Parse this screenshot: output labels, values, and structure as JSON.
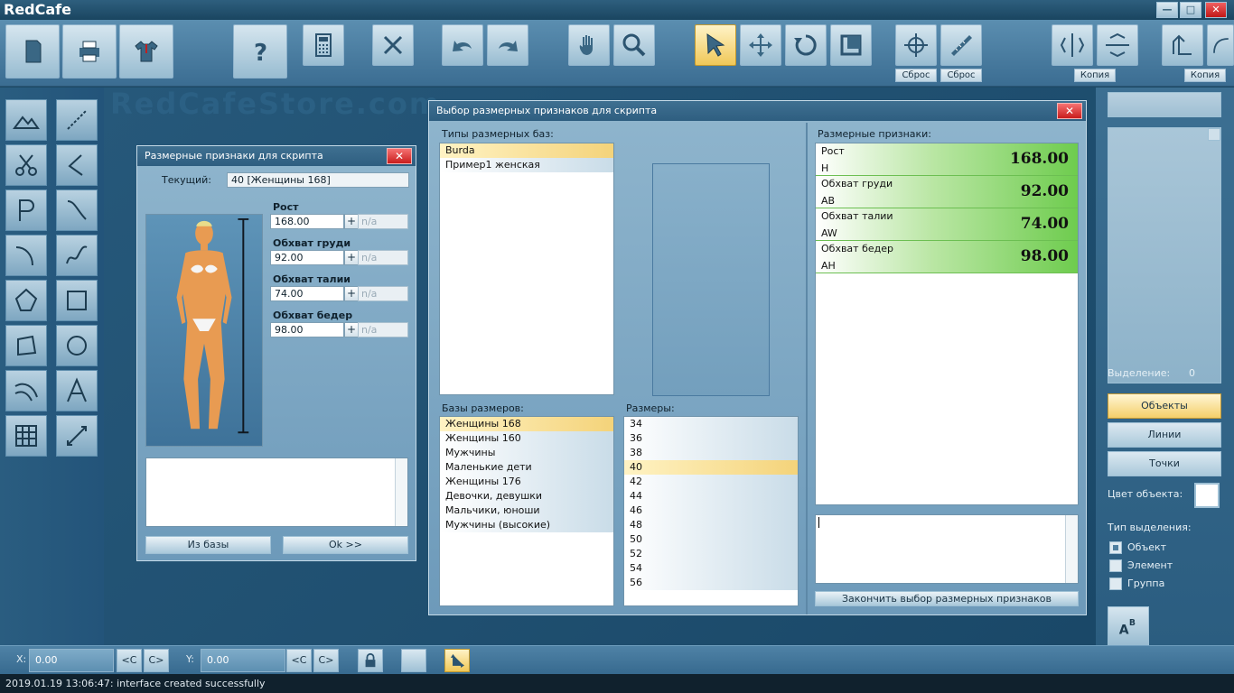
{
  "app": {
    "title": "RedCafe",
    "watermark": "RedCafeStore.com"
  },
  "window_controls": {
    "minimize": "—",
    "maximize": "□",
    "close": "✕"
  },
  "toolbar": {
    "labels": {
      "reset1": "Сброс",
      "reset2": "Сброс",
      "copy1": "Копия",
      "copy2": "Копия"
    }
  },
  "dialog_small": {
    "title": "Размерные признаки для скрипта",
    "current_label": "Текущий:",
    "current_value": "40  [Женщины 168]",
    "measures": [
      {
        "label": "Рост",
        "value": "168.00",
        "na": "n/a"
      },
      {
        "label": "Обхват груди",
        "value": "92.00",
        "na": "n/a"
      },
      {
        "label": "Обхват талии",
        "value": "74.00",
        "na": "n/a"
      },
      {
        "label": "Обхват бедер",
        "value": "98.00",
        "na": "n/a"
      }
    ],
    "plus": "+",
    "btn_from_base": "Из базы",
    "btn_ok": "Ok >>"
  },
  "dialog_main": {
    "title": "Выбор размерных признаков для скрипта",
    "types_label": "Типы размерных баз:",
    "types": [
      "Burda",
      "Пример1 женская"
    ],
    "bases_label": "Базы размеров:",
    "bases": [
      "Женщины 168",
      "Женщины 160",
      "Мужчины",
      "Маленькие дети",
      "Женщины 176",
      "Девочки, девушки",
      "Мальчики, юноши",
      "Мужчины (высокие)"
    ],
    "sizes_label": "Размеры:",
    "sizes": [
      "34",
      "36",
      "38",
      "40",
      "42",
      "44",
      "46",
      "48",
      "50",
      "52",
      "54",
      "56"
    ],
    "features_label": "Размерные признаки:",
    "features": [
      {
        "name": "Рост",
        "code": "H",
        "value": "168.00"
      },
      {
        "name": "Обхват груди",
        "code": "AB",
        "value": "92.00"
      },
      {
        "name": "Обхват талии",
        "code": "AW",
        "value": "74.00"
      },
      {
        "name": "Обхват бедер",
        "code": "AH",
        "value": "98.00"
      }
    ],
    "finish_button": "Закончить выбор размерных признаков"
  },
  "right_panel": {
    "selection_label": "Выделение:",
    "selection_count": "0",
    "btn_objects": "Объекты",
    "btn_lines": "Линии",
    "btn_points": "Точки",
    "color_label": "Цвет объекта:",
    "sel_type_label": "Тип выделения:",
    "types": [
      "Объект",
      "Элемент",
      "Группа"
    ]
  },
  "coords": {
    "x_label": "X:",
    "x_value": "0.00",
    "y_label": "Y:",
    "y_value": "0.00",
    "prev": "<C",
    "next": "C>"
  },
  "status": "2019.01.19 13:06:47: interface created successfully",
  "colors": {
    "accent": "#f4cf6a",
    "green": "#6ecc4e",
    "close": "#c91d1d"
  }
}
